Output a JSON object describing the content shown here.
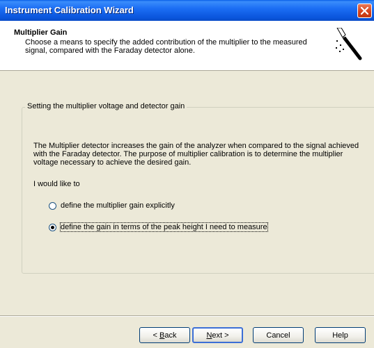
{
  "window": {
    "title": "Instrument Calibration Wizard"
  },
  "header": {
    "title": "Multiplier Gain",
    "description": "Choose a means to specify the added contribution of the multiplier to the measured signal, compared with the Faraday detector alone."
  },
  "group": {
    "legend": "Setting the multiplier voltage and detector gain",
    "paragraph": "The Multiplier detector increases the gain of the analyzer when compared to the signal achieved with the Faraday detector.  The purpose of multiplier calibration is to determine the multiplier voltage necessary to achieve the desired gain.",
    "prompt": "I would like to",
    "options": [
      {
        "label": "define the multiplier gain explicitly",
        "checked": false
      },
      {
        "label": "define the gain in terms of the peak height I need to measure",
        "checked": true
      }
    ]
  },
  "buttons": {
    "back_prefix": "< ",
    "back_mnemonic": "B",
    "back_rest": "ack",
    "next_mnemonic": "N",
    "next_rest": "ext >",
    "cancel": "Cancel",
    "help": "Help"
  },
  "icons": {
    "close": "close-icon",
    "wizard": "magic-wand-icon"
  }
}
